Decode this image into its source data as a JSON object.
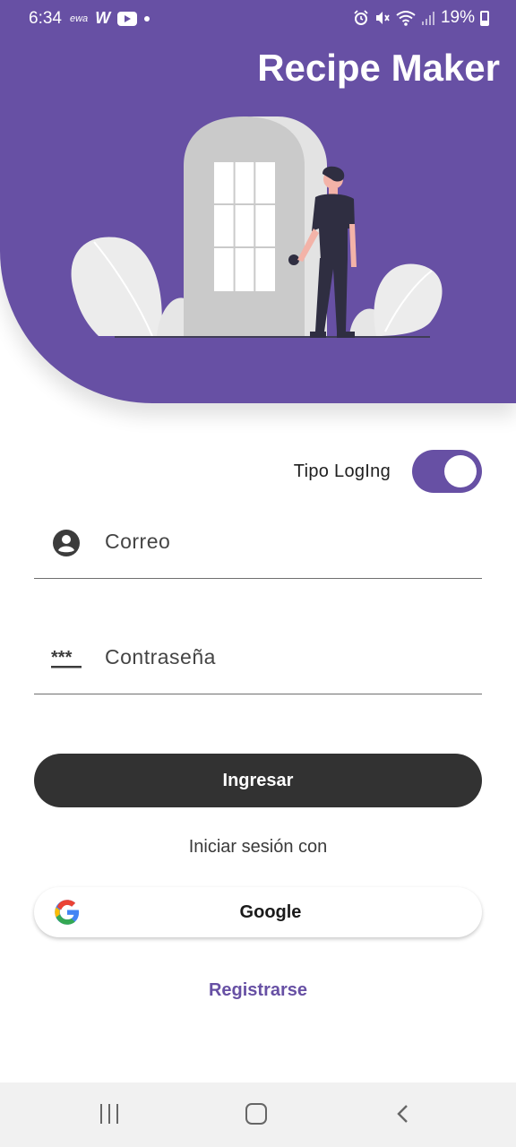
{
  "status_bar": {
    "time": "6:34",
    "left_icons": [
      "ewa-icon",
      "w-icon",
      "youtube-icon",
      "dot-icon"
    ],
    "ewa_text": "ewa",
    "w_text": "W",
    "right_icons": [
      "alarm-icon",
      "mute-icon",
      "wifi-icon",
      "signal-icon",
      "battery-icon"
    ],
    "battery": "19%"
  },
  "header": {
    "title": "Recipe Maker",
    "background_color": "#6750a4"
  },
  "login_type": {
    "label": "Tipo LogIng",
    "toggle_on": true
  },
  "email_field": {
    "placeholder": "Correo",
    "icon": "account-circle-icon"
  },
  "password_field": {
    "placeholder": "Contraseña",
    "icon": "password-icon",
    "icon_text": "***"
  },
  "login_button": {
    "label": "Ingresar",
    "color": "#323232"
  },
  "signin_with": "Iniciar sesión con",
  "google_button": {
    "label": "Google",
    "icon": "google-icon"
  },
  "register_link": {
    "label": "Registrarse",
    "color": "#6750a4"
  },
  "nav_bar": {
    "buttons": [
      "recent-apps-icon",
      "home-icon",
      "back-icon"
    ]
  }
}
